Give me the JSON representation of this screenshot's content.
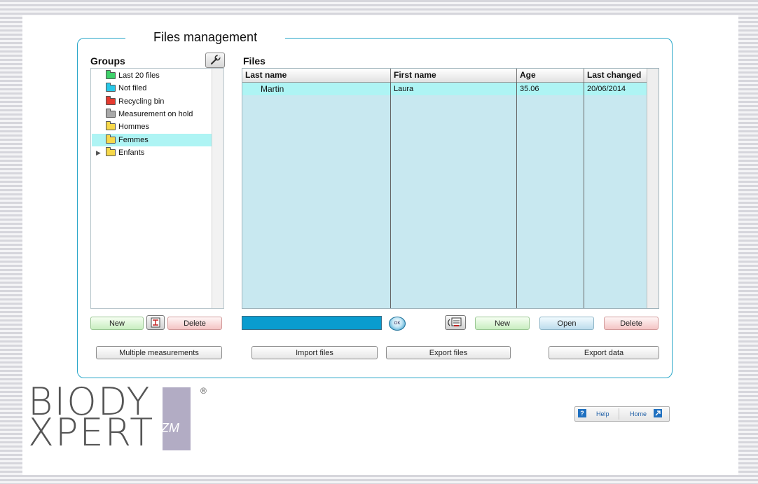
{
  "window": {
    "title": "Files management"
  },
  "groups": {
    "header": "Groups",
    "items": [
      {
        "label": "Last 20 files",
        "color": "#3fd16a",
        "selected": false,
        "expandable": false
      },
      {
        "label": "Not filed",
        "color": "#28c8e8",
        "selected": false,
        "expandable": false
      },
      {
        "label": "Recycling bin",
        "color": "#e53a2f",
        "selected": false,
        "expandable": false
      },
      {
        "label": "Measurement on hold",
        "color": "#a9a9a9",
        "selected": false,
        "expandable": false
      },
      {
        "label": "Hommes",
        "color": "#f7d84a",
        "selected": false,
        "expandable": false
      },
      {
        "label": "Femmes",
        "color": "#f7d84a",
        "selected": true,
        "expandable": false
      },
      {
        "label": "Enfants",
        "color": "#f7d84a",
        "selected": false,
        "expandable": true
      }
    ],
    "buttons": {
      "new": "New",
      "delete": "Delete"
    }
  },
  "files": {
    "header": "Files",
    "columns": [
      "Last name",
      "First name",
      "Age",
      "Last changed"
    ],
    "rows": [
      {
        "last_name": "Martin",
        "first_name": "Laura",
        "age": "35.06",
        "last_changed": "20/06/2014"
      }
    ],
    "buttons": {
      "new": "New",
      "open": "Open",
      "delete": "Delete"
    },
    "search": {
      "value": "",
      "ok_label": "OK"
    }
  },
  "bottom_buttons": {
    "multiple": "Multiple measurements",
    "import": "Import files",
    "export_files": "Export files",
    "export_data": "Export data"
  },
  "logo": {
    "line1": "BIODY",
    "line2": "XPERT",
    "zm": "ZM",
    "reg": "®"
  },
  "footer": {
    "help": "Help",
    "home": "Home",
    "help_icon": "?"
  },
  "colors": {
    "accent": "#2aa7c9",
    "selected_row": "#aef4f4",
    "table_bg": "#c8e8f0",
    "search_bg": "#0a9ccf"
  }
}
